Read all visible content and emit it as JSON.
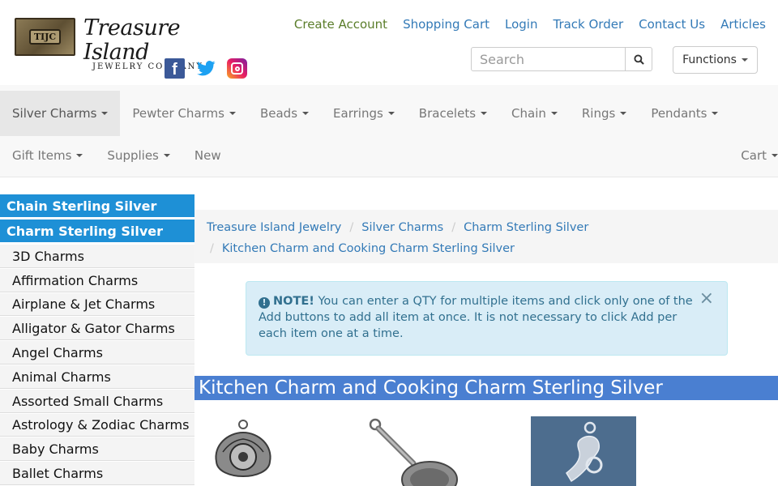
{
  "brand": {
    "logo_text": "TIJC",
    "name": "Treasure Island",
    "tagline": "JEWELRY COMPANY"
  },
  "social": {
    "facebook": "f"
  },
  "top_links": {
    "create_account": "Create Account",
    "shopping_cart": "Shopping Cart",
    "login": "Login",
    "track_order": "Track Order",
    "contact_us": "Contact Us",
    "articles": "Articles"
  },
  "search": {
    "placeholder": "Search"
  },
  "functions_label": "Functions",
  "nav": {
    "row1": [
      "Silver Charms",
      "Pewter Charms",
      "Beads",
      "Earrings",
      "Bracelets",
      "Chain",
      "Rings",
      "Pendants"
    ],
    "row2": [
      "Gift Items",
      "Supplies",
      "New"
    ],
    "cart": "Cart"
  },
  "sidebar": {
    "heading1": "Chain Sterling Silver",
    "heading2": "Charm Sterling Silver",
    "items": [
      "3D Charms",
      "Affirmation Charms",
      "Airplane & Jet Charms",
      "Alligator & Gator Charms",
      "Angel Charms",
      "Animal Charms",
      "Assorted Small Charms",
      "Astrology & Zodiac Charms",
      "Baby Charms",
      "Ballet Charms"
    ]
  },
  "breadcrumb": [
    "Treasure Island Jewelry",
    "Silver Charms",
    "Charm Sterling Silver",
    "Kitchen Charm and Cooking Charm Sterling Silver"
  ],
  "alert": {
    "label": "NOTE!",
    "text": "You can enter a QTY for multiple items and click only one of the Add buttons to add all item at once. It is not necessary to click Add per each item one at a time.",
    "close": "×"
  },
  "page_title": "Kitchen Charm and Cooking Charm Sterling Silver"
}
